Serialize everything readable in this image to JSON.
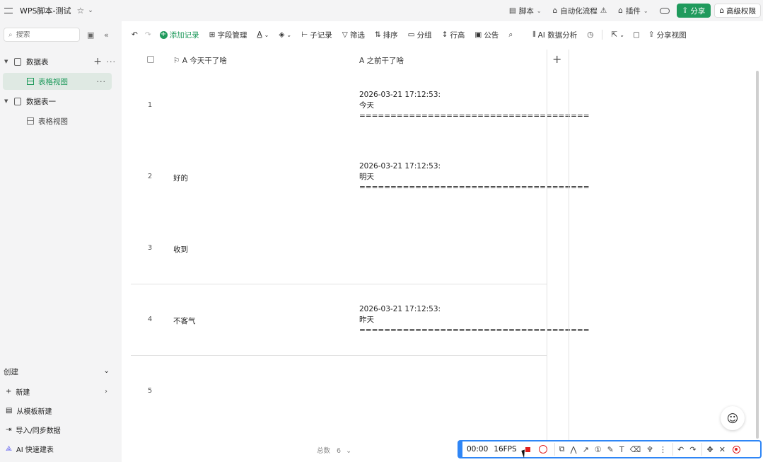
{
  "app": {
    "title": "WPS脚本-测试",
    "top_actions": [
      {
        "label": "脚本"
      },
      {
        "label": "自动化流程"
      },
      {
        "label": "插件"
      }
    ],
    "share_label": "分享",
    "permission_label": "高级权限"
  },
  "sidebar": {
    "search_placeholder": "搜索",
    "tree": [
      {
        "label": "数据表",
        "type": "table"
      },
      {
        "label": "表格视图",
        "type": "view",
        "active": true
      },
      {
        "label": "数据表一",
        "type": "table"
      },
      {
        "label": "表格视图",
        "type": "view",
        "active": false
      }
    ],
    "create_title": "创建",
    "create_items": [
      {
        "label": "新建"
      },
      {
        "label": "从模板新建"
      },
      {
        "label": "导入/同步数据"
      },
      {
        "label": "AI 快速建表"
      }
    ]
  },
  "toolbar": {
    "add_record": "添加记录",
    "field_manage": "字段管理",
    "sub_record": "子记录",
    "filter": "筛选",
    "sort": "排序",
    "group": "分组",
    "row_height": "行高",
    "notice": "公告",
    "ai_analysis": "AI 数据分析",
    "share_view": "分享视图"
  },
  "table": {
    "columns": [
      "今天干了啥",
      "之前干了啥"
    ],
    "rows": [
      {
        "num": "1",
        "c1": "",
        "c2": "2026-03-21 17:12:53:\n今天\n====================================="
      },
      {
        "num": "2",
        "c1": "好的",
        "c2": "2026-03-21 17:12:53:\n明天\n====================================="
      },
      {
        "num": "3",
        "c1": "收到",
        "c2": ""
      },
      {
        "num": "4",
        "c1": "不客气",
        "c2": "2026-03-21 17:12:53:\n昨天\n====================================="
      },
      {
        "num": "5",
        "c1": "",
        "c2": ""
      }
    ],
    "total_label": "总数",
    "total_value": "6"
  },
  "recorder": {
    "time": "00:00",
    "fps": "16FPS"
  },
  "colors": {
    "accent": "#1f9a5c",
    "recorder_border": "#2f86f6",
    "record_red": "#e02020"
  }
}
